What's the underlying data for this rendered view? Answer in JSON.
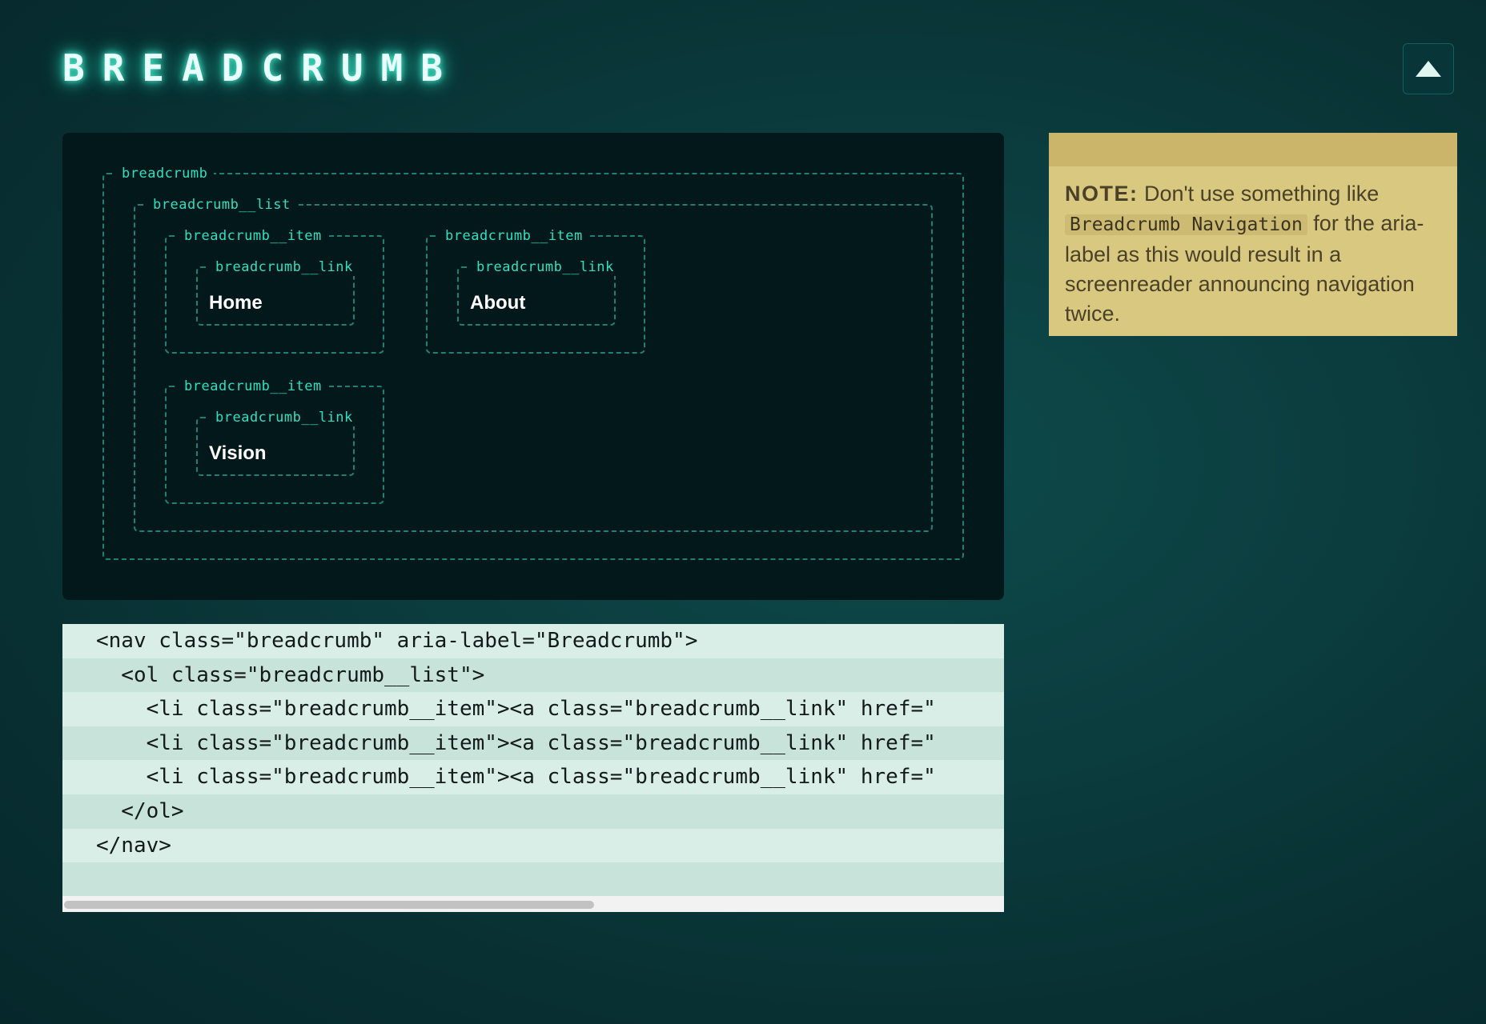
{
  "header": {
    "title": "BREADCRUMB"
  },
  "demo": {
    "nav_label": "breadcrumb",
    "list_label": "breadcrumb__list",
    "items": [
      {
        "item_label": "breadcrumb__item",
        "link_label": "breadcrumb__link",
        "text": "Home"
      },
      {
        "item_label": "breadcrumb__item",
        "link_label": "breadcrumb__link",
        "text": "About"
      },
      {
        "item_label": "breadcrumb__item",
        "link_label": "breadcrumb__link",
        "text": "Vision"
      }
    ]
  },
  "note": {
    "strong": "NOTE:",
    "text_before": " Don't use something like ",
    "code": "Breadcrumb Navigation",
    "text_after": " for the aria-label as this would result in a screenreader announcing navigation twice."
  },
  "code_lines": [
    "<nav class=\"breadcrumb\" aria-label=\"Breadcrumb\">",
    "  <ol class=\"breadcrumb__list\">",
    "    <li class=\"breadcrumb__item\"><a class=\"breadcrumb__link\" href=\"",
    "    <li class=\"breadcrumb__item\"><a class=\"breadcrumb__link\" href=\"",
    "    <li class=\"breadcrumb__item\"><a class=\"breadcrumb__link\" href=\"",
    "  </ol>",
    "</nav>",
    ""
  ],
  "icons": {
    "scroll_top": "triangle-up-icon"
  },
  "colors": {
    "accent": "#2fe0c0",
    "note_bg": "#d9c880",
    "code_bg": "#d6ede6"
  }
}
